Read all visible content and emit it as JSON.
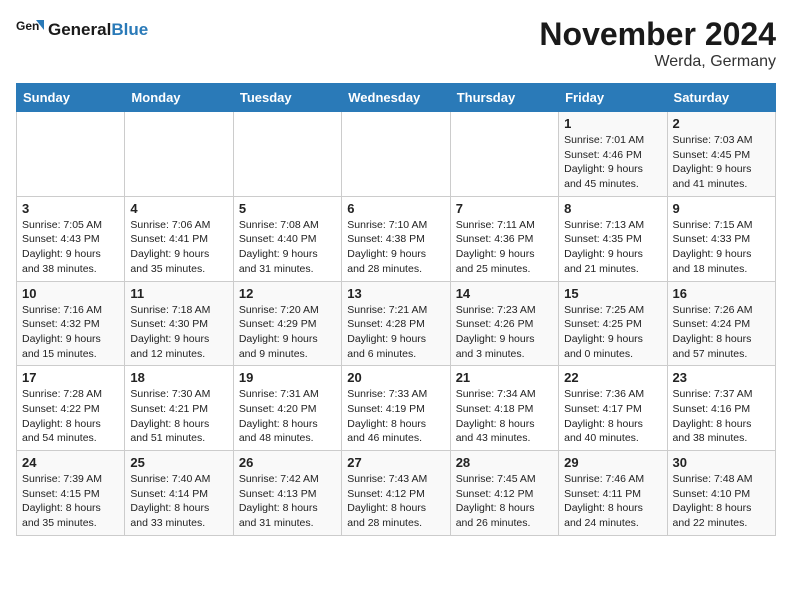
{
  "header": {
    "logo_line1": "General",
    "logo_line2": "Blue",
    "month_title": "November 2024",
    "location": "Werda, Germany"
  },
  "weekdays": [
    "Sunday",
    "Monday",
    "Tuesday",
    "Wednesday",
    "Thursday",
    "Friday",
    "Saturday"
  ],
  "weeks": [
    [
      {
        "day": "",
        "info": ""
      },
      {
        "day": "",
        "info": ""
      },
      {
        "day": "",
        "info": ""
      },
      {
        "day": "",
        "info": ""
      },
      {
        "day": "",
        "info": ""
      },
      {
        "day": "1",
        "info": "Sunrise: 7:01 AM\nSunset: 4:46 PM\nDaylight: 9 hours\nand 45 minutes."
      },
      {
        "day": "2",
        "info": "Sunrise: 7:03 AM\nSunset: 4:45 PM\nDaylight: 9 hours\nand 41 minutes."
      }
    ],
    [
      {
        "day": "3",
        "info": "Sunrise: 7:05 AM\nSunset: 4:43 PM\nDaylight: 9 hours\nand 38 minutes."
      },
      {
        "day": "4",
        "info": "Sunrise: 7:06 AM\nSunset: 4:41 PM\nDaylight: 9 hours\nand 35 minutes."
      },
      {
        "day": "5",
        "info": "Sunrise: 7:08 AM\nSunset: 4:40 PM\nDaylight: 9 hours\nand 31 minutes."
      },
      {
        "day": "6",
        "info": "Sunrise: 7:10 AM\nSunset: 4:38 PM\nDaylight: 9 hours\nand 28 minutes."
      },
      {
        "day": "7",
        "info": "Sunrise: 7:11 AM\nSunset: 4:36 PM\nDaylight: 9 hours\nand 25 minutes."
      },
      {
        "day": "8",
        "info": "Sunrise: 7:13 AM\nSunset: 4:35 PM\nDaylight: 9 hours\nand 21 minutes."
      },
      {
        "day": "9",
        "info": "Sunrise: 7:15 AM\nSunset: 4:33 PM\nDaylight: 9 hours\nand 18 minutes."
      }
    ],
    [
      {
        "day": "10",
        "info": "Sunrise: 7:16 AM\nSunset: 4:32 PM\nDaylight: 9 hours\nand 15 minutes."
      },
      {
        "day": "11",
        "info": "Sunrise: 7:18 AM\nSunset: 4:30 PM\nDaylight: 9 hours\nand 12 minutes."
      },
      {
        "day": "12",
        "info": "Sunrise: 7:20 AM\nSunset: 4:29 PM\nDaylight: 9 hours\nand 9 minutes."
      },
      {
        "day": "13",
        "info": "Sunrise: 7:21 AM\nSunset: 4:28 PM\nDaylight: 9 hours\nand 6 minutes."
      },
      {
        "day": "14",
        "info": "Sunrise: 7:23 AM\nSunset: 4:26 PM\nDaylight: 9 hours\nand 3 minutes."
      },
      {
        "day": "15",
        "info": "Sunrise: 7:25 AM\nSunset: 4:25 PM\nDaylight: 9 hours\nand 0 minutes."
      },
      {
        "day": "16",
        "info": "Sunrise: 7:26 AM\nSunset: 4:24 PM\nDaylight: 8 hours\nand 57 minutes."
      }
    ],
    [
      {
        "day": "17",
        "info": "Sunrise: 7:28 AM\nSunset: 4:22 PM\nDaylight: 8 hours\nand 54 minutes."
      },
      {
        "day": "18",
        "info": "Sunrise: 7:30 AM\nSunset: 4:21 PM\nDaylight: 8 hours\nand 51 minutes."
      },
      {
        "day": "19",
        "info": "Sunrise: 7:31 AM\nSunset: 4:20 PM\nDaylight: 8 hours\nand 48 minutes."
      },
      {
        "day": "20",
        "info": "Sunrise: 7:33 AM\nSunset: 4:19 PM\nDaylight: 8 hours\nand 46 minutes."
      },
      {
        "day": "21",
        "info": "Sunrise: 7:34 AM\nSunset: 4:18 PM\nDaylight: 8 hours\nand 43 minutes."
      },
      {
        "day": "22",
        "info": "Sunrise: 7:36 AM\nSunset: 4:17 PM\nDaylight: 8 hours\nand 40 minutes."
      },
      {
        "day": "23",
        "info": "Sunrise: 7:37 AM\nSunset: 4:16 PM\nDaylight: 8 hours\nand 38 minutes."
      }
    ],
    [
      {
        "day": "24",
        "info": "Sunrise: 7:39 AM\nSunset: 4:15 PM\nDaylight: 8 hours\nand 35 minutes."
      },
      {
        "day": "25",
        "info": "Sunrise: 7:40 AM\nSunset: 4:14 PM\nDaylight: 8 hours\nand 33 minutes."
      },
      {
        "day": "26",
        "info": "Sunrise: 7:42 AM\nSunset: 4:13 PM\nDaylight: 8 hours\nand 31 minutes."
      },
      {
        "day": "27",
        "info": "Sunrise: 7:43 AM\nSunset: 4:12 PM\nDaylight: 8 hours\nand 28 minutes."
      },
      {
        "day": "28",
        "info": "Sunrise: 7:45 AM\nSunset: 4:12 PM\nDaylight: 8 hours\nand 26 minutes."
      },
      {
        "day": "29",
        "info": "Sunrise: 7:46 AM\nSunset: 4:11 PM\nDaylight: 8 hours\nand 24 minutes."
      },
      {
        "day": "30",
        "info": "Sunrise: 7:48 AM\nSunset: 4:10 PM\nDaylight: 8 hours\nand 22 minutes."
      }
    ]
  ]
}
